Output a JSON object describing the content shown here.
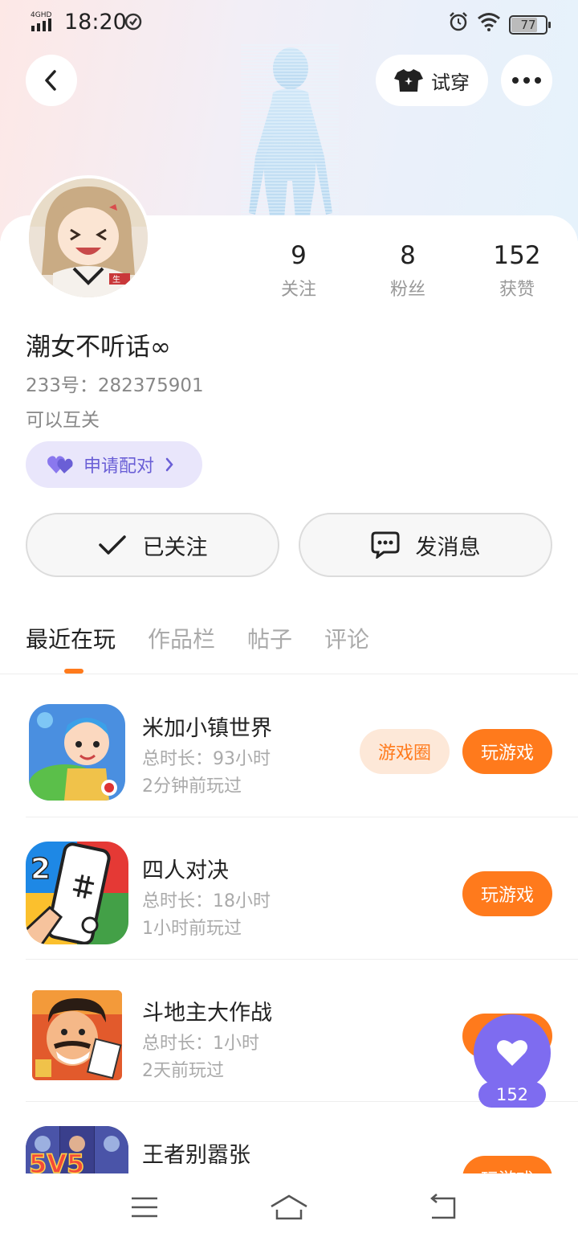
{
  "status_bar": {
    "network": "4GHD",
    "time": "18:20",
    "battery": "77"
  },
  "header": {
    "tryon_label": "试穿"
  },
  "profile": {
    "stats": [
      {
        "num": "9",
        "label": "关注"
      },
      {
        "num": "8",
        "label": "粉丝"
      },
      {
        "num": "152",
        "label": "获赞"
      }
    ],
    "nickname": "潮女不听话∞",
    "uid": "233号：282375901",
    "bio": "可以互关",
    "pair_label": "申请配对",
    "avatar_tag": "生"
  },
  "actions": {
    "follow_label": "已关注",
    "message_label": "发消息"
  },
  "tabs": [
    {
      "label": "最近在玩"
    },
    {
      "label": "作品栏"
    },
    {
      "label": "帖子"
    },
    {
      "label": "评论"
    }
  ],
  "games": [
    {
      "title": "米加小镇世界",
      "duration": "总时长：93小时",
      "last_played": "2分钟前玩过",
      "circle_label": "游戏圈",
      "play_label": "玩游戏"
    },
    {
      "title": "四人对决",
      "duration": "总时长：18小时",
      "last_played": "1小时前玩过",
      "play_label": "玩游戏",
      "icon_text": "2"
    },
    {
      "title": "斗地主大作战",
      "duration": "总时长：1小时",
      "last_played": "2天前玩过",
      "play_label": "玩游戏"
    },
    {
      "title": "王者别嚣张",
      "play_label": "玩游戏",
      "icon_text": "5V5"
    }
  ],
  "like_fab": {
    "count": "152"
  },
  "colors": {
    "accent_orange": "#ff7a1c",
    "accent_purple": "#7e6cf0",
    "pair_bg": "#e9e6fb"
  }
}
